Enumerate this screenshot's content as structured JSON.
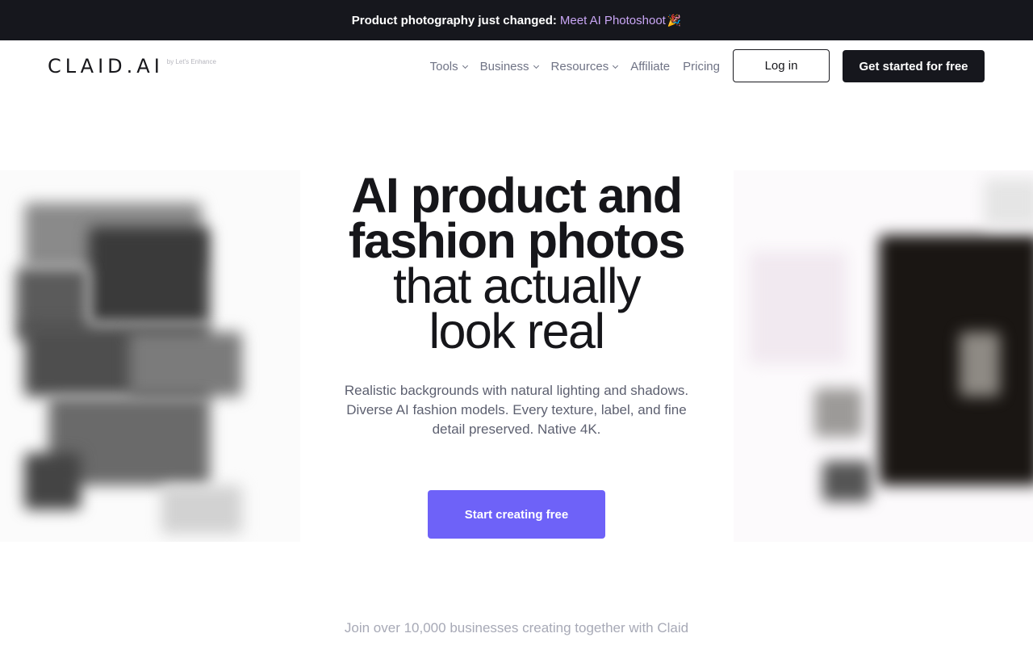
{
  "announcement": {
    "text": "Product photography just changed:",
    "link": "Meet AI Photoshoot",
    "emoji": "🎉"
  },
  "header": {
    "logo": "CLAID.AI",
    "logo_byline": "by Let's Enhance",
    "nav": [
      {
        "label": "Tools",
        "dropdown": true
      },
      {
        "label": "Business",
        "dropdown": true
      },
      {
        "label": "Resources",
        "dropdown": true
      },
      {
        "label": "Affiliate",
        "dropdown": false
      },
      {
        "label": "Pricing",
        "dropdown": false
      }
    ],
    "login_label": "Log in",
    "get_started_label": "Get started for free"
  },
  "hero": {
    "title_bold_line1": "AI product and",
    "title_bold_line2": "fashion photos",
    "title_light_line1": "that actually",
    "title_light_line2": "look real",
    "subtitle": "Realistic backgrounds with natural lighting and shadows. Diverse AI fashion models. Every texture, label, and fine detail preserved. Native 4K.",
    "cta_label": "Start creating free"
  },
  "social_proof": {
    "text": "Join over 10,000 businesses creating together with Claid"
  },
  "colors": {
    "announcement_bg": "#16171d",
    "announcement_link": "#c9a6f5",
    "cta_bg": "#6e62f8",
    "dark_button_bg": "#16171d",
    "nav_text": "#6f7385"
  },
  "icons": {
    "dropdown": "chevron-down-icon",
    "announcement": "party-popper-icon"
  }
}
